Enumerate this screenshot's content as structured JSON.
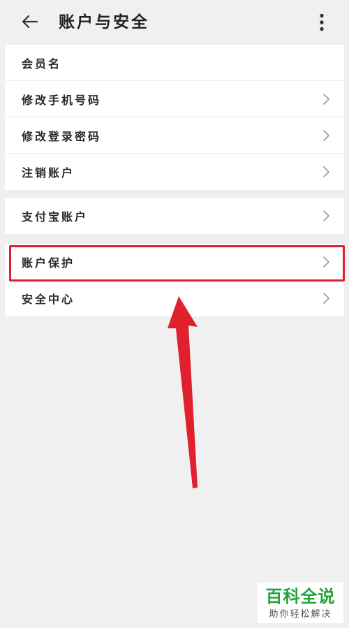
{
  "header": {
    "title": "账户与安全",
    "back_icon": "arrow-left-icon",
    "more_icon": "more-vertical-icon"
  },
  "group1": {
    "items": [
      {
        "label": "会员名",
        "has_chevron": false
      },
      {
        "label": "修改手机号码",
        "has_chevron": true
      },
      {
        "label": "修改登录密码",
        "has_chevron": true
      },
      {
        "label": "注销账户",
        "has_chevron": true
      }
    ]
  },
  "group2": {
    "items": [
      {
        "label": "支付宝账户",
        "has_chevron": true
      }
    ]
  },
  "group3": {
    "items": [
      {
        "label": "账户保护",
        "has_chevron": true,
        "highlighted": true
      },
      {
        "label": "安全中心",
        "has_chevron": true
      }
    ]
  },
  "annotation": {
    "highlight_color": "#e0202c",
    "arrow_color": "#e0202c"
  },
  "watermark": {
    "main": "百科全说",
    "sub": "助你轻松解决",
    "color": "#22a339"
  }
}
